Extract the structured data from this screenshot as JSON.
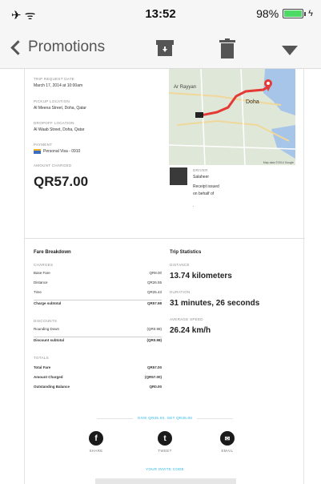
{
  "status_bar": {
    "signal": "✈ ᯤ",
    "time": "13:52",
    "battery": "98%",
    "battery_level": 0.98,
    "battery_color": "#4cd964"
  },
  "nav": {
    "back_label": "Promotions",
    "icons": [
      "back-chevron-icon",
      "archive-icon",
      "trash-icon",
      "menu-triangle-icon"
    ]
  },
  "trip": {
    "request_date_label": "TRIP REQUEST DATE",
    "request_date": "March 17, 2014 at 10:00am",
    "pickup_label": "PICKUP LOCATION",
    "pickup": "Al Meena Street, Doha, Qatar",
    "dropoff_label": "DROPOFF LOCATION",
    "dropoff": "Al Waab Street, Doha, Qatar",
    "payment_label": "PAYMENT",
    "payment": "Personal Visa - 0910",
    "amount_label": "AMOUNT CHARGED",
    "amount": "QR57.00"
  },
  "map": {
    "labels": [
      "Ar Rayyan",
      "Doha"
    ],
    "attribution": "Map data ©2014 Google",
    "route_color": "#e53935"
  },
  "driver": {
    "label": "DRIVER",
    "name": "Salaheer",
    "line1": "Receipt issued",
    "line2": "on behalf of",
    "line3": "."
  },
  "fare": {
    "title": "Fare Breakdown",
    "charges_label": "CHARGES",
    "charges": [
      {
        "label": "Base Fare",
        "value": "QR8.00"
      },
      {
        "label": "Distance",
        "value": "QR26.55"
      },
      {
        "label": "Time",
        "value": "QR25.43"
      }
    ],
    "charge_subtotal": {
      "label": "Charge subtotal",
      "value": "QR57.98"
    },
    "discounts_label": "DISCOUNTS",
    "discounts": [
      {
        "label": "Rounding Down",
        "value": "(QR0.98)"
      }
    ],
    "discount_subtotal": {
      "label": "Discount subtotal",
      "value": "(QR0.98)"
    },
    "totals_label": "TOTALS",
    "totals": [
      {
        "label": "Total Fare",
        "value": "QR57.00"
      },
      {
        "label": "Amount Charged",
        "value": "(QR57.00)"
      },
      {
        "label": "Outstanding Balance",
        "value": "QR0.00"
      }
    ]
  },
  "stats": {
    "title": "Trip Statistics",
    "distance_label": "DISTANCE",
    "distance": "13.74 kilometers",
    "duration_label": "DURATION",
    "duration": "31 minutes, 26 seconds",
    "speed_label": "AVERAGE SPEED",
    "speed": "26.24 km/h"
  },
  "promo": {
    "text": "GIVE QR35.00, GET QR35.00",
    "share": [
      {
        "label": "SHARE",
        "icon": "facebook-icon",
        "glyph": "f"
      },
      {
        "label": "TWEET",
        "icon": "twitter-icon",
        "glyph": "t"
      },
      {
        "label": "EMAIL",
        "icon": "email-icon",
        "glyph": "✉"
      }
    ],
    "invite_label": "YOUR INVITE CODE"
  }
}
